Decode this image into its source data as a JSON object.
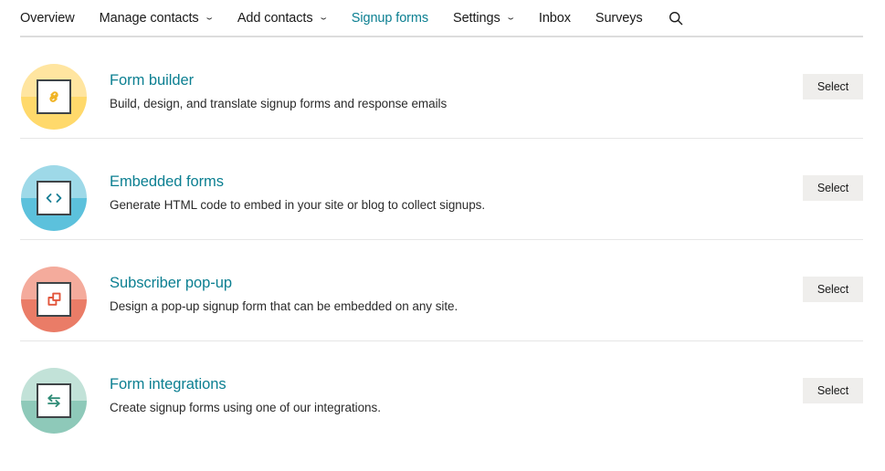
{
  "nav": {
    "items": [
      {
        "label": "Overview",
        "has_caret": false,
        "active": false,
        "name": "nav-item-overview"
      },
      {
        "label": "Manage contacts",
        "has_caret": true,
        "active": false,
        "name": "nav-item-manage-contacts"
      },
      {
        "label": "Add contacts",
        "has_caret": true,
        "active": false,
        "name": "nav-item-add-contacts"
      },
      {
        "label": "Signup forms",
        "has_caret": false,
        "active": true,
        "name": "nav-item-signup-forms"
      },
      {
        "label": "Settings",
        "has_caret": true,
        "active": false,
        "name": "nav-item-settings"
      },
      {
        "label": "Inbox",
        "has_caret": false,
        "active": false,
        "name": "nav-item-inbox"
      },
      {
        "label": "Surveys",
        "has_caret": false,
        "active": false,
        "name": "nav-item-surveys"
      }
    ],
    "caret_glyph": "⌄",
    "search_icon": "search-icon",
    "active_color": "#0b7f91",
    "text_color": "#1a1a1a"
  },
  "rows": [
    {
      "title": "Form builder",
      "description": "Build, design, and translate signup forms and response emails",
      "button_label": "Select",
      "icon_name": "link-icon",
      "circle_top": "#ffe5a0",
      "circle_bottom": "#ffd96b",
      "glyph_color": "#f0b323"
    },
    {
      "title": "Embedded forms",
      "description": "Generate HTML code to embed in your site or blog to collect signups.",
      "button_label": "Select",
      "icon_name": "code-brackets-icon",
      "circle_top": "#9ed9e8",
      "circle_bottom": "#5cc1dc",
      "glyph_color": "#1b7f96"
    },
    {
      "title": "Subscriber pop-up",
      "description": "Design a pop-up signup form that can be embedded on any site.",
      "button_label": "Select",
      "icon_name": "popup-windows-icon",
      "circle_top": "#f4ab9c",
      "circle_bottom": "#ea7c67",
      "glyph_color": "#e2563c"
    },
    {
      "title": "Form integrations",
      "description": "Create signup forms using one of our integrations.",
      "button_label": "Select",
      "icon_name": "exchange-arrows-icon",
      "circle_top": "#c2e2d8",
      "circle_bottom": "#8ec9b9",
      "glyph_color": "#2e8b76"
    }
  ],
  "colors": {
    "accent_teal": "#0b7f91",
    "button_bg": "#efeeec",
    "divider": "#e6e6e6",
    "nav_border": "#dcdcdc"
  }
}
